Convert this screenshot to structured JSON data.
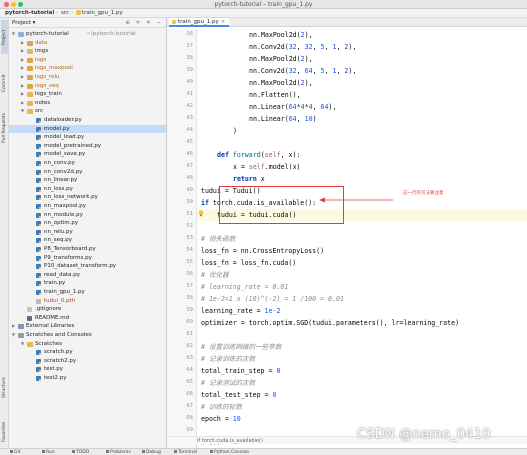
{
  "window": {
    "title": "pytorch-tutorial – train_gpu_1.py",
    "traffic_colors": [
      "#ff5f57",
      "#febc2e",
      "#28c840"
    ]
  },
  "navbar": {
    "crumbs": [
      "pytorch-tutorial",
      "src",
      "train_gpu_1.py"
    ]
  },
  "left_strip": {
    "tabs": [
      "Project",
      "Commit",
      "Pull Requests",
      "Structure",
      "Favorites"
    ]
  },
  "project": {
    "label": "Project",
    "tools": "⊕ ≑ ✶ −",
    "tree": [
      {
        "depth": 0,
        "icon": "folder-blue",
        "arrow": "▾",
        "name": "pytorch-tutorial",
        "hint": "~/pytorch-tutorial",
        "style": ""
      },
      {
        "depth": 1,
        "icon": "folder-x",
        "arrow": "▸",
        "name": "data",
        "style": "orange"
      },
      {
        "depth": 1,
        "icon": "folder",
        "arrow": "▸",
        "name": "imgs",
        "style": ""
      },
      {
        "depth": 1,
        "icon": "folder-x",
        "arrow": "▸",
        "name": "logs",
        "style": "orange"
      },
      {
        "depth": 1,
        "icon": "folder-x",
        "arrow": "▸",
        "name": "logs_maxpool",
        "style": "orange"
      },
      {
        "depth": 1,
        "icon": "folder-x",
        "arrow": "▸",
        "name": "logs_relu",
        "style": "orange"
      },
      {
        "depth": 1,
        "icon": "folder-x",
        "arrow": "▸",
        "name": "logs_seq",
        "style": "orange"
      },
      {
        "depth": 1,
        "icon": "folder",
        "arrow": "▸",
        "name": "logs_train",
        "style": ""
      },
      {
        "depth": 1,
        "icon": "folder",
        "arrow": "▸",
        "name": "notes",
        "style": ""
      },
      {
        "depth": 1,
        "icon": "folder",
        "arrow": "▾",
        "name": "src",
        "style": ""
      },
      {
        "depth": 2,
        "icon": "py",
        "arrow": "",
        "name": "dataloader.py",
        "style": ""
      },
      {
        "depth": 2,
        "icon": "py",
        "arrow": "",
        "name": "model.py",
        "style": "",
        "selected": true
      },
      {
        "depth": 2,
        "icon": "py",
        "arrow": "",
        "name": "model_load.py",
        "style": ""
      },
      {
        "depth": 2,
        "icon": "py",
        "arrow": "",
        "name": "model_pretrained.py",
        "style": ""
      },
      {
        "depth": 2,
        "icon": "py",
        "arrow": "",
        "name": "model_save.py",
        "style": ""
      },
      {
        "depth": 2,
        "icon": "py",
        "arrow": "",
        "name": "nn_conv.py",
        "style": ""
      },
      {
        "depth": 2,
        "icon": "py",
        "arrow": "",
        "name": "nn_conv2d.py",
        "style": ""
      },
      {
        "depth": 2,
        "icon": "py",
        "arrow": "",
        "name": "nn_linear.py",
        "style": ""
      },
      {
        "depth": 2,
        "icon": "py",
        "arrow": "",
        "name": "nn_loss.py",
        "style": ""
      },
      {
        "depth": 2,
        "icon": "py",
        "arrow": "",
        "name": "nn_loss_network.py",
        "style": ""
      },
      {
        "depth": 2,
        "icon": "py",
        "arrow": "",
        "name": "nn_maxpool.py",
        "style": ""
      },
      {
        "depth": 2,
        "icon": "py",
        "arrow": "",
        "name": "nn_module.py",
        "style": ""
      },
      {
        "depth": 2,
        "icon": "py",
        "arrow": "",
        "name": "nn_optim.py",
        "style": ""
      },
      {
        "depth": 2,
        "icon": "py",
        "arrow": "",
        "name": "nn_relu.py",
        "style": ""
      },
      {
        "depth": 2,
        "icon": "py",
        "arrow": "",
        "name": "nn_seq.py",
        "style": ""
      },
      {
        "depth": 2,
        "icon": "py",
        "arrow": "",
        "name": "P8_Tensorboard.py",
        "style": ""
      },
      {
        "depth": 2,
        "icon": "py",
        "arrow": "",
        "name": "P9_transforms.py",
        "style": ""
      },
      {
        "depth": 2,
        "icon": "py",
        "arrow": "",
        "name": "P10_dataset_transform.py",
        "style": ""
      },
      {
        "depth": 2,
        "icon": "py",
        "arrow": "",
        "name": "read_data.py",
        "style": ""
      },
      {
        "depth": 2,
        "icon": "py",
        "arrow": "",
        "name": "train.py",
        "style": ""
      },
      {
        "depth": 2,
        "icon": "py",
        "arrow": "",
        "name": "train_gpu_1.py",
        "style": ""
      },
      {
        "depth": 2,
        "icon": "pth",
        "arrow": "",
        "name": "tudui_0.pth",
        "style": "red"
      },
      {
        "depth": 1,
        "icon": "gi",
        "arrow": "",
        "name": ".gitignore",
        "style": ""
      },
      {
        "depth": 1,
        "icon": "md",
        "arrow": "",
        "name": "README.md",
        "style": ""
      },
      {
        "depth": 0,
        "icon": "lib",
        "arrow": "▸",
        "name": "External Libraries",
        "style": ""
      },
      {
        "depth": 0,
        "icon": "scratch",
        "arrow": "▾",
        "name": "Scratches and Consoles",
        "style": ""
      },
      {
        "depth": 1,
        "icon": "folder",
        "arrow": "▾",
        "name": "Scratches",
        "style": ""
      },
      {
        "depth": 2,
        "icon": "py",
        "arrow": "",
        "name": "scratch.py",
        "style": ""
      },
      {
        "depth": 2,
        "icon": "py",
        "arrow": "",
        "name": "scratch2.py",
        "style": ""
      },
      {
        "depth": 2,
        "icon": "py",
        "arrow": "",
        "name": "test.py",
        "style": ""
      },
      {
        "depth": 2,
        "icon": "py",
        "arrow": "",
        "name": "test2.py",
        "style": ""
      }
    ]
  },
  "editor": {
    "tab_label": "train_gpu_1.py",
    "lines": [
      {
        "n": "36",
        "indent": 12,
        "tokens": [
          [
            "plain",
            "nn.MaxPool2d("
          ],
          [
            "num",
            "2"
          ],
          [
            "plain",
            "),"
          ]
        ]
      },
      {
        "n": "37",
        "indent": 12,
        "tokens": [
          [
            "plain",
            "nn.Conv2d("
          ],
          [
            "num",
            "32"
          ],
          [
            "plain",
            ", "
          ],
          [
            "num",
            "32"
          ],
          [
            "plain",
            ", "
          ],
          [
            "num",
            "5"
          ],
          [
            "plain",
            ", "
          ],
          [
            "num",
            "1"
          ],
          [
            "plain",
            ", "
          ],
          [
            "num",
            "2"
          ],
          [
            "plain",
            "),"
          ]
        ]
      },
      {
        "n": "38",
        "indent": 12,
        "tokens": [
          [
            "plain",
            "nn.MaxPool2d("
          ],
          [
            "num",
            "2"
          ],
          [
            "plain",
            "),"
          ]
        ]
      },
      {
        "n": "39",
        "indent": 12,
        "tokens": [
          [
            "plain",
            "nn.Conv2d("
          ],
          [
            "num",
            "32"
          ],
          [
            "plain",
            ", "
          ],
          [
            "num",
            "64"
          ],
          [
            "plain",
            ", "
          ],
          [
            "num",
            "5"
          ],
          [
            "plain",
            ", "
          ],
          [
            "num",
            "1"
          ],
          [
            "plain",
            ", "
          ],
          [
            "num",
            "2"
          ],
          [
            "plain",
            "),"
          ]
        ]
      },
      {
        "n": "40",
        "indent": 12,
        "tokens": [
          [
            "plain",
            "nn.MaxPool2d("
          ],
          [
            "num",
            "2"
          ],
          [
            "plain",
            "),"
          ]
        ]
      },
      {
        "n": "41",
        "indent": 12,
        "tokens": [
          [
            "plain",
            "nn.Flatten(),"
          ]
        ]
      },
      {
        "n": "42",
        "indent": 12,
        "tokens": [
          [
            "plain",
            "nn.Linear("
          ],
          [
            "num",
            "64"
          ],
          [
            "plain",
            "*"
          ],
          [
            "num",
            "4"
          ],
          [
            "plain",
            "*"
          ],
          [
            "num",
            "4"
          ],
          [
            "plain",
            ", "
          ],
          [
            "num",
            "64"
          ],
          [
            "plain",
            "),"
          ]
        ]
      },
      {
        "n": "43",
        "indent": 12,
        "tokens": [
          [
            "plain",
            "nn.Linear("
          ],
          [
            "num",
            "64"
          ],
          [
            "plain",
            ", "
          ],
          [
            "num",
            "10"
          ],
          [
            "plain",
            ")"
          ]
        ]
      },
      {
        "n": "44",
        "indent": 8,
        "tokens": [
          [
            "plain",
            ")"
          ]
        ]
      },
      {
        "n": "45",
        "indent": 0,
        "tokens": []
      },
      {
        "n": "46",
        "indent": 4,
        "tokens": [
          [
            "kw",
            "def "
          ],
          [
            "fn",
            "forward"
          ],
          [
            "plain",
            "("
          ],
          [
            "slf",
            "self"
          ],
          [
            "plain",
            ", x):"
          ]
        ]
      },
      {
        "n": "47",
        "indent": 8,
        "tokens": [
          [
            "plain",
            "x = "
          ],
          [
            "slf",
            "self"
          ],
          [
            "plain",
            ".model(x)"
          ]
        ]
      },
      {
        "n": "48",
        "indent": 8,
        "tokens": [
          [
            "kw",
            "return "
          ],
          [
            "plain",
            "x"
          ]
        ]
      },
      {
        "n": "49",
        "indent": 0,
        "tokens": [
          [
            "plain",
            "tudui = Tudui()"
          ]
        ]
      },
      {
        "n": "50",
        "indent": 0,
        "tokens": [
          [
            "kw",
            "if "
          ],
          [
            "plain",
            "torch.cuda.is_available():"
          ]
        ]
      },
      {
        "n": "51",
        "indent": 4,
        "tokens": [
          [
            "plain",
            "tudui = tudui.cuda()"
          ]
        ],
        "caret": true
      },
      {
        "n": "52",
        "indent": 0,
        "tokens": []
      },
      {
        "n": "53",
        "indent": 0,
        "tokens": [
          [
            "cm",
            "# 损失函数"
          ]
        ]
      },
      {
        "n": "54",
        "indent": 0,
        "tokens": [
          [
            "plain",
            "loss_fn = nn.CrossEntropyLoss()"
          ]
        ]
      },
      {
        "n": "55",
        "indent": 0,
        "tokens": [
          [
            "plain",
            "loss_fn = loss_fn.cuda()"
          ]
        ]
      },
      {
        "n": "56",
        "indent": 0,
        "tokens": [
          [
            "cm",
            "# 优化器"
          ]
        ]
      },
      {
        "n": "57",
        "indent": 0,
        "tokens": [
          [
            "cm",
            "# learning_rate = 0.01"
          ]
        ]
      },
      {
        "n": "58",
        "indent": 0,
        "tokens": [
          [
            "cm",
            "# 1e-2=1 x (10)^(-2) = 1 /100 = 0.01"
          ]
        ]
      },
      {
        "n": "59",
        "indent": 0,
        "tokens": [
          [
            "plain",
            "learning_rate = "
          ],
          [
            "num",
            "1e-2"
          ]
        ]
      },
      {
        "n": "60",
        "indent": 0,
        "tokens": [
          [
            "plain",
            "optimizer = torch.optim.SGD(tudui.parameters(), lr=learning_rate)"
          ]
        ]
      },
      {
        "n": "61",
        "indent": 0,
        "tokens": []
      },
      {
        "n": "62",
        "indent": 0,
        "tokens": [
          [
            "cm",
            "# 设置训练网络的一些参数"
          ]
        ]
      },
      {
        "n": "63",
        "indent": 0,
        "tokens": [
          [
            "cm",
            "# 记录训练的次数"
          ]
        ]
      },
      {
        "n": "64",
        "indent": 0,
        "tokens": [
          [
            "plain",
            "total_train_step = "
          ],
          [
            "num",
            "0"
          ]
        ]
      },
      {
        "n": "65",
        "indent": 0,
        "tokens": [
          [
            "cm",
            "# 记录测试的次数"
          ]
        ]
      },
      {
        "n": "66",
        "indent": 0,
        "tokens": [
          [
            "plain",
            "total_test_step = "
          ],
          [
            "num",
            "0"
          ]
        ]
      },
      {
        "n": "67",
        "indent": 0,
        "tokens": [
          [
            "cm",
            "# 训练的轮数"
          ]
        ]
      },
      {
        "n": "68",
        "indent": 0,
        "tokens": [
          [
            "plain",
            "epoch = "
          ],
          [
            "num",
            "10"
          ]
        ]
      },
      {
        "n": "69",
        "indent": 0,
        "tokens": []
      },
      {
        "n": "70",
        "indent": 0,
        "tokens": [
          [
            "cm",
            "# ..."
          ]
        ]
      }
    ],
    "annotation": "这一行的写法要注意",
    "status_crumb": "if torch.cuda.is_available()",
    "annotation_color": "#e23a3a"
  },
  "bottom_bar": {
    "items": [
      "Git",
      "Run",
      "TODO",
      "Problems",
      "Debug",
      "Terminal",
      "Python Console"
    ]
  },
  "watermark": "CSDN @nemo_0410"
}
